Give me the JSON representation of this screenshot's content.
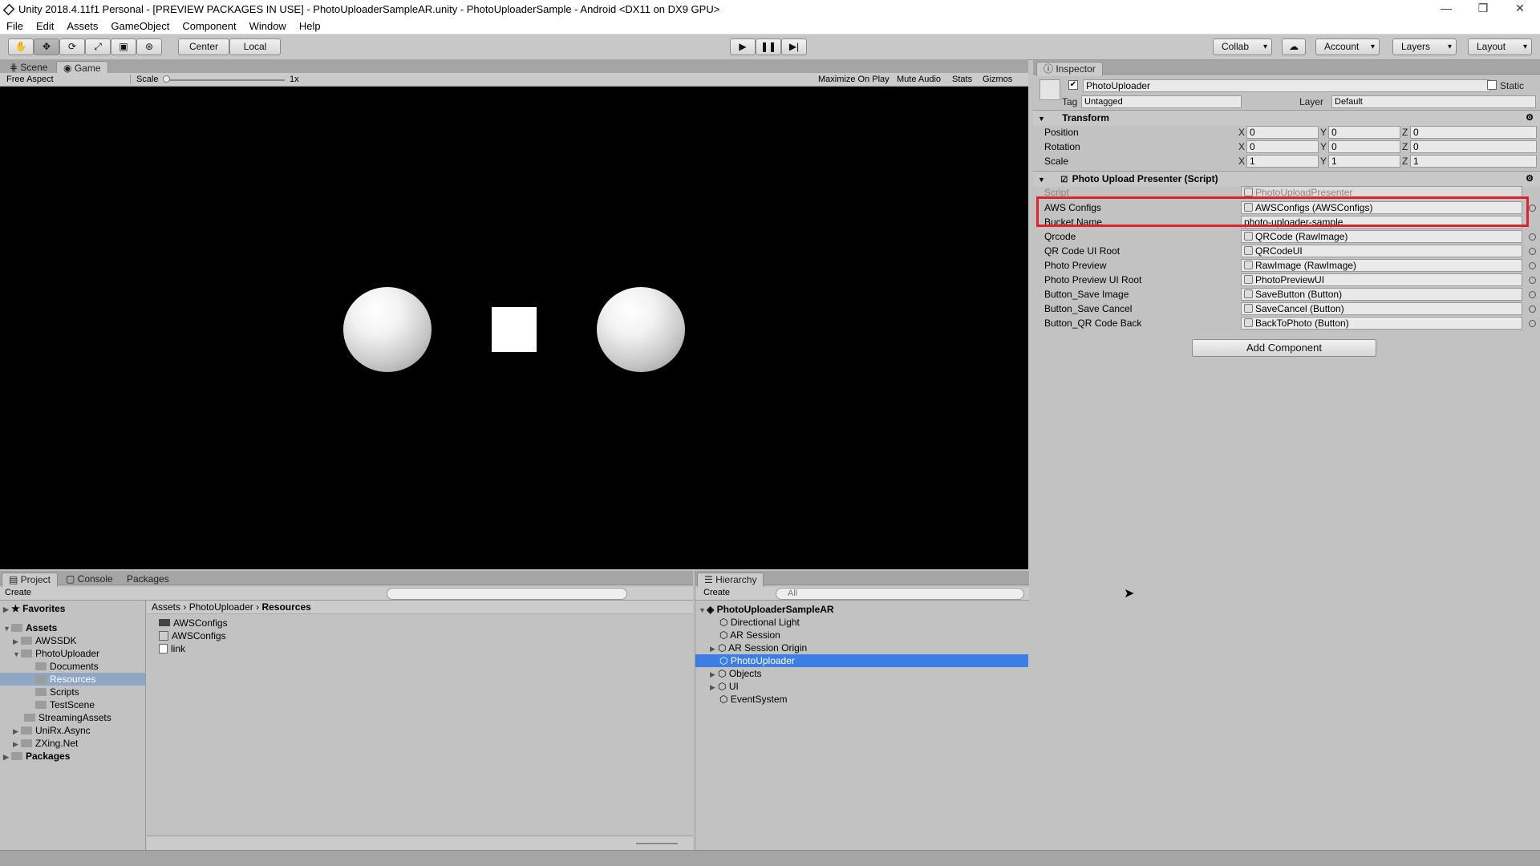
{
  "window": {
    "title": "Unity 2018.4.11f1 Personal - [PREVIEW PACKAGES IN USE] - PhotoUploaderSampleAR.unity - PhotoUploaderSample - Android <DX11 on DX9 GPU>"
  },
  "menu": [
    "File",
    "Edit",
    "Assets",
    "GameObject",
    "Component",
    "Window",
    "Help"
  ],
  "toolbar": {
    "pivot": "Center",
    "space": "Local",
    "collab": "Collab",
    "account": "Account",
    "layers": "Layers",
    "layout": "Layout"
  },
  "scene_tabs": {
    "scene": "Scene",
    "game": "Game"
  },
  "gamebar": {
    "aspect": "Free Aspect",
    "scale_label": "Scale",
    "scale_value": "1x",
    "maximize": "Maximize On Play",
    "mute": "Mute Audio",
    "stats": "Stats",
    "gizmos": "Gizmos"
  },
  "inspector": {
    "tab": "Inspector",
    "object_name": "PhotoUploader",
    "static_label": "Static",
    "tag_label": "Tag",
    "tag_value": "Untagged",
    "layer_label": "Layer",
    "layer_value": "Default",
    "transform": {
      "title": "Transform",
      "rows": [
        {
          "label": "Position",
          "x": "0",
          "y": "0",
          "z": "0"
        },
        {
          "label": "Rotation",
          "x": "0",
          "y": "0",
          "z": "0"
        },
        {
          "label": "Scale",
          "x": "1",
          "y": "1",
          "z": "1"
        }
      ]
    },
    "script_component": {
      "title": "Photo Upload Presenter (Script)",
      "script_label": "Script",
      "script_value": "PhotoUploadPresenter",
      "fields": [
        {
          "label": "AWS Configs",
          "value": "AWSConfigs (AWSConfigs)"
        },
        {
          "label": "Bucket Name",
          "value": "photo-uploader-sample"
        },
        {
          "label": "Qrcode",
          "value": "QRCode (RawImage)"
        },
        {
          "label": "QR Code UI Root",
          "value": "QRCodeUI"
        },
        {
          "label": "Photo Preview",
          "value": "RawImage (RawImage)"
        },
        {
          "label": "Photo Preview UI Root",
          "value": "PhotoPreviewUI"
        },
        {
          "label": "Button_Save Image",
          "value": "SaveButton (Button)"
        },
        {
          "label": "Button_Save Cancel",
          "value": "SaveCancel (Button)"
        },
        {
          "label": "Button_QR Code Back",
          "value": "BackToPhoto (Button)"
        }
      ]
    },
    "add_component": "Add Component",
    "highlight_color": "#e0202a"
  },
  "project": {
    "tabs": [
      "Project",
      "Console",
      "Packages"
    ],
    "create": "Create",
    "breadcrumb": [
      "Assets",
      "PhotoUploader",
      "Resources"
    ],
    "tree": [
      {
        "label": "Favorites",
        "level": 0,
        "bold": true
      },
      {
        "label": "Assets",
        "level": 0,
        "bold": true
      },
      {
        "label": "AWSSDK",
        "level": 1
      },
      {
        "label": "PhotoUploader",
        "level": 1
      },
      {
        "label": "Documents",
        "level": 2
      },
      {
        "label": "Resources",
        "level": 2,
        "selected": true
      },
      {
        "label": "Scripts",
        "level": 2
      },
      {
        "label": "TestScene",
        "level": 2
      },
      {
        "label": "StreamingAssets",
        "level": 1
      },
      {
        "label": "UniRx.Async",
        "level": 1
      },
      {
        "label": "ZXing.Net",
        "level": 1
      },
      {
        "label": "Packages",
        "level": 0,
        "bold": true
      }
    ],
    "files": [
      "AWSConfigs",
      "AWSConfigs",
      "link"
    ]
  },
  "hierarchy": {
    "tab": "Hierarchy",
    "create": "Create",
    "search_placeholder": "All",
    "scene": "PhotoUploaderSampleAR",
    "items": [
      {
        "label": "Directional Light"
      },
      {
        "label": "AR Session"
      },
      {
        "label": "AR Session Origin",
        "expandable": true
      },
      {
        "label": "PhotoUploader",
        "selected": true
      },
      {
        "label": "Objects",
        "expandable": true
      },
      {
        "label": "UI",
        "expandable": true
      },
      {
        "label": "EventSystem"
      }
    ]
  }
}
